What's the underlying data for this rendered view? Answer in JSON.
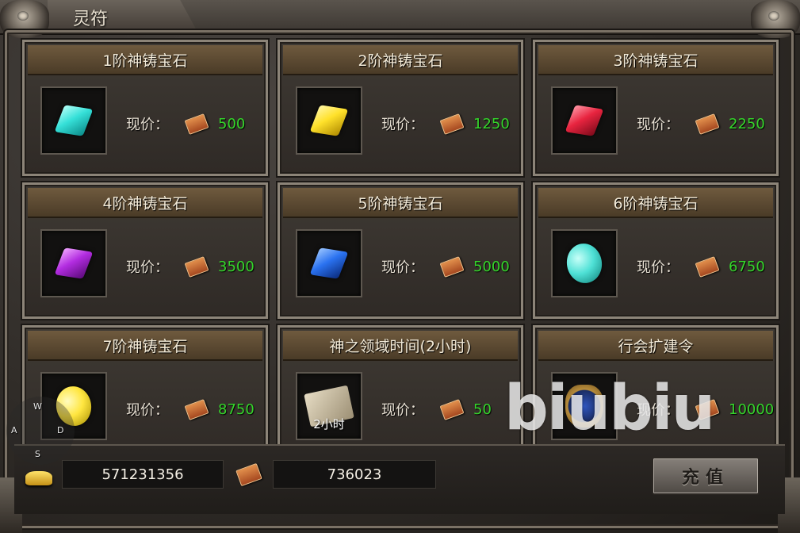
{
  "window": {
    "title": "灵符"
  },
  "labels": {
    "price_label": "现价："
  },
  "items": [
    {
      "name": "1阶神铸宝石",
      "price": "500",
      "icon": "cyan-gem-icon",
      "color": "#35e0d8"
    },
    {
      "name": "2阶神铸宝石",
      "price": "1250",
      "icon": "yellow-gem-icon",
      "color": "#ffe12a"
    },
    {
      "name": "3阶神铸宝石",
      "price": "2250",
      "icon": "red-gem-icon",
      "color": "#e8243f"
    },
    {
      "name": "4阶神铸宝石",
      "price": "3500",
      "icon": "purple-gem-icon",
      "color": "#b22ce0"
    },
    {
      "name": "5阶神铸宝石",
      "price": "5000",
      "icon": "blue-gem-icon",
      "color": "#2a72f0"
    },
    {
      "name": "6阶神铸宝石",
      "price": "6750",
      "icon": "aqua-gem-icon",
      "color": "#4fe1d6"
    },
    {
      "name": "7阶神铸宝石",
      "price": "8750",
      "icon": "gold-gem-icon",
      "color": "#ffe640"
    },
    {
      "name": "神之领域时间(2小时)",
      "price": "50",
      "icon": "scroll-icon",
      "caption": "2小时"
    },
    {
      "name": "行会扩建令",
      "price": "10000",
      "icon": "guild-badge-icon"
    }
  ],
  "footer": {
    "gold_amount": "571231356",
    "ticket_amount": "736023",
    "recharge_label": "充值"
  },
  "joystick": {
    "up": "W",
    "left": "A",
    "right": "D",
    "down": "S"
  },
  "watermark": "biubiu",
  "colors": {
    "price_green": "#35d52b",
    "header_brown": "#6f5a3e"
  }
}
